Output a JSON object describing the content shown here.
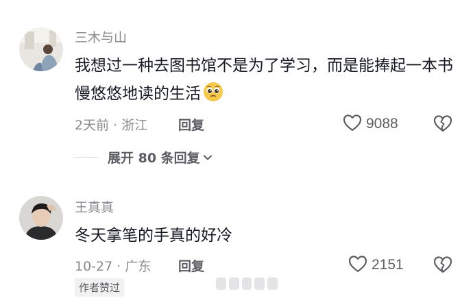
{
  "comments": [
    {
      "username": "三木与山",
      "text": "我想过一种去图书馆不是为了学习，而是能捧起一本书慢悠悠地读的生活",
      "emoji": "pleading-face-emoji",
      "time_location": "2天前 · 浙江",
      "reply_label": "回复",
      "like_count": "9088",
      "expand_label": "展开 80 条回复"
    },
    {
      "username": "王真真",
      "text": "冬天拿笔的手真的好冷",
      "time_location": "10-27 · 广东",
      "reply_label": "回复",
      "like_count": "2151",
      "badge": "作者赞过"
    }
  ],
  "icons": {
    "like": "heart-outline-icon",
    "dislike": "broken-heart-icon",
    "expand": "chevron-down-icon"
  },
  "colors": {
    "text": "#161823",
    "secondary": "#8a8b91",
    "action": "#5c5d63"
  }
}
